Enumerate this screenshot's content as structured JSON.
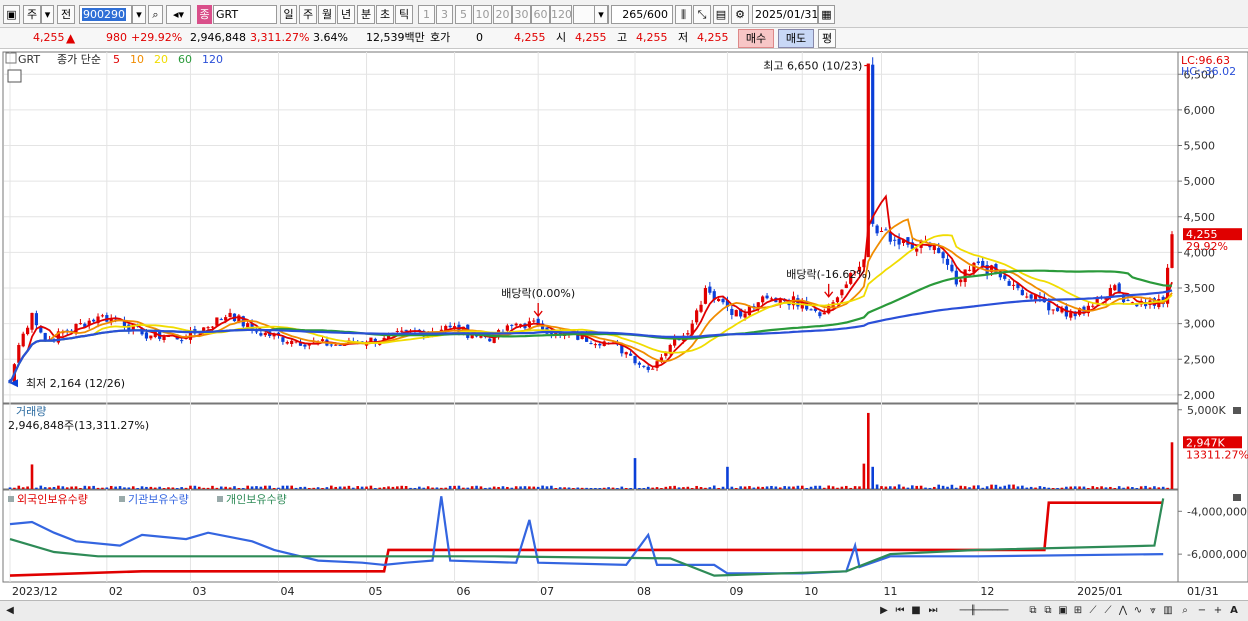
{
  "toolbar": {
    "market_label": "주",
    "prev_label": "전",
    "code_value": "900290",
    "stock_badge": "종",
    "stock_name": "GRT",
    "periods": [
      "일",
      "주",
      "월",
      "년",
      "분",
      "초",
      "틱"
    ],
    "selected_period": "일",
    "intervals": [
      "1",
      "3",
      "5",
      "10",
      "20",
      "30",
      "60",
      "120"
    ],
    "count_value": "265",
    "count_total": "/600",
    "date_value": "2025/01/31"
  },
  "quote": {
    "price": "4,255",
    "change": "980",
    "change_pct": "+29.92%",
    "volume": "2,946,848",
    "volume_ratio": "3,311.27%",
    "turnover": "3.64%",
    "amount": "12,539백만",
    "hoga_label": "호가",
    "hoga_value": "0",
    "hoga_price": "4,255",
    "open_label": "시",
    "open_value": "4,255",
    "high_label": "고",
    "high_value": "4,255",
    "low_label": "저",
    "low_value": "4,255",
    "buy_label": "매수",
    "sell_label": "매도",
    "eval_label": "평"
  },
  "colors": {
    "up": "#e00000",
    "down": "#0a3fd8",
    "ma5": "#e00000",
    "ma10": "#f08c00",
    "ma20": "#f0dc00",
    "ma60": "#2a9a3a",
    "ma120": "#2a4fd8",
    "foreign": "#e00000",
    "institution": "#3465e0",
    "individual": "#2e8b57"
  },
  "chart_data": [
    {
      "type": "candlestick",
      "legend_code": "GRT",
      "legend_title": "종가 단순",
      "ma_periods": [
        "5",
        "10",
        "20",
        "60",
        "120"
      ],
      "y_ticks": [
        "6,500",
        "6,000",
        "5,500",
        "5,000",
        "4,500",
        "4,000",
        "3,500",
        "3,000",
        "2,500",
        "2,000"
      ],
      "y_range": [
        1900,
        6700
      ],
      "x_months": [
        "2023/12",
        "02",
        "03",
        "04",
        "05",
        "06",
        "07",
        "08",
        "09",
        "10",
        "11",
        "12",
        "2025/01",
        "01/31"
      ],
      "x_month_index": [
        0,
        22,
        41,
        61,
        81,
        101,
        120,
        142,
        163,
        180,
        198,
        220,
        242
      ],
      "n_bars": 265,
      "close_keypoints": [
        [
          0,
          2164
        ],
        [
          2,
          2700
        ],
        [
          5,
          3150
        ],
        [
          8,
          2750
        ],
        [
          20,
          3100
        ],
        [
          25,
          3050
        ],
        [
          30,
          2850
        ],
        [
          40,
          2800
        ],
        [
          50,
          3150
        ],
        [
          55,
          2900
        ],
        [
          65,
          2750
        ],
        [
          75,
          2700
        ],
        [
          85,
          2800
        ],
        [
          100,
          2950
        ],
        [
          105,
          2850
        ],
        [
          110,
          2800
        ],
        [
          115,
          3000
        ],
        [
          120,
          2980
        ],
        [
          125,
          2850
        ],
        [
          135,
          2750
        ],
        [
          140,
          2600
        ],
        [
          145,
          2350
        ],
        [
          150,
          2700
        ],
        [
          155,
          3000
        ],
        [
          158,
          3500
        ],
        [
          162,
          3300
        ],
        [
          166,
          3100
        ],
        [
          170,
          3300
        ],
        [
          175,
          3350
        ],
        [
          180,
          3300
        ],
        [
          185,
          3150
        ],
        [
          190,
          3550
        ],
        [
          194,
          3900
        ],
        [
          195,
          6650
        ],
        [
          196,
          4400
        ],
        [
          198,
          4300
        ],
        [
          200,
          4150
        ],
        [
          205,
          4050
        ],
        [
          210,
          4100
        ],
        [
          215,
          3550
        ],
        [
          220,
          3850
        ],
        [
          225,
          3650
        ],
        [
          230,
          3400
        ],
        [
          235,
          3300
        ],
        [
          240,
          3100
        ],
        [
          245,
          3250
        ],
        [
          250,
          3500
        ],
        [
          255,
          3300
        ],
        [
          262,
          3275
        ],
        [
          264,
          4255
        ]
      ],
      "annotations": [
        {
          "label": "최고 6,650 (10/23)",
          "index": 195,
          "value": 6650
        },
        {
          "label": "최저 2,164 (12/26)",
          "index": 0,
          "value": 2164
        },
        {
          "label": "배당락(0.00%)",
          "index": 120,
          "value": 2980
        },
        {
          "label": "배당락(-16.62%)",
          "index": 186,
          "value": 3250
        }
      ],
      "lc_label": "LC:96.63",
      "hc_label": "HC:-36.02",
      "last_price_label": "4,255",
      "last_pct_label": "29.92%"
    },
    {
      "type": "bar",
      "title": "거래량",
      "subtitle": "2,946,848주(13,311.27%)",
      "y_ticks": [
        "5,000K"
      ],
      "y_range": [
        0,
        5300000
      ],
      "last_label": "2,947K",
      "last_pct_label": "13311.27%",
      "spikes": [
        [
          5,
          1550000
        ],
        [
          142,
          1950000
        ],
        [
          163,
          1400000
        ],
        [
          194,
          1600000
        ],
        [
          195,
          4800000
        ],
        [
          196,
          1400000
        ],
        [
          264,
          2947000
        ]
      ]
    },
    {
      "type": "line",
      "legend": [
        "외국인보유수량",
        "기관보유수량",
        "개인보유수량"
      ],
      "y_ticks": [
        "-4,000,000",
        "-6,000,000"
      ],
      "y_range": [
        -7300000,
        -3100000
      ],
      "series": [
        {
          "name": "외국인보유수량",
          "points": [
            [
              0,
              -7000000
            ],
            [
              30,
              -6800000
            ],
            [
              85,
              -6800000
            ],
            [
              86,
              -5800000
            ],
            [
              215,
              -5800000
            ],
            [
              235,
              -5800000
            ],
            [
              236,
              -3600000
            ],
            [
              262,
              -3600000
            ]
          ]
        },
        {
          "name": "기관보유수량",
          "points": [
            [
              0,
              -4600000
            ],
            [
              5,
              -4500000
            ],
            [
              10,
              -5000000
            ],
            [
              15,
              -5400000
            ],
            [
              25,
              -5600000
            ],
            [
              30,
              -5100000
            ],
            [
              40,
              -5300000
            ],
            [
              45,
              -5000000
            ],
            [
              55,
              -5400000
            ],
            [
              60,
              -5800000
            ],
            [
              70,
              -6300000
            ],
            [
              80,
              -6400000
            ],
            [
              85,
              -6500000
            ],
            [
              90,
              -6400000
            ],
            [
              96,
              -6300000
            ],
            [
              98,
              -3300000
            ],
            [
              100,
              -6300000
            ],
            [
              115,
              -6400000
            ],
            [
              118,
              -4400000
            ],
            [
              120,
              -6400000
            ],
            [
              140,
              -6500000
            ],
            [
              145,
              -5100000
            ],
            [
              147,
              -6500000
            ],
            [
              160,
              -6500000
            ],
            [
              163,
              -6900000
            ],
            [
              180,
              -6900000
            ],
            [
              190,
              -6800000
            ],
            [
              192,
              -5600000
            ],
            [
              193,
              -6600000
            ],
            [
              200,
              -6100000
            ],
            [
              220,
              -6100000
            ],
            [
              262,
              -6000000
            ]
          ]
        },
        {
          "name": "개인보유수량",
          "points": [
            [
              0,
              -5300000
            ],
            [
              10,
              -5900000
            ],
            [
              20,
              -6100000
            ],
            [
              60,
              -6100000
            ],
            [
              80,
              -6100000
            ],
            [
              110,
              -6100000
            ],
            [
              150,
              -6200000
            ],
            [
              160,
              -7000000
            ],
            [
              190,
              -6800000
            ],
            [
              200,
              -6000000
            ],
            [
              220,
              -5800000
            ],
            [
              260,
              -5600000
            ],
            [
              262,
              -3400000
            ]
          ]
        }
      ]
    }
  ],
  "bottom": {
    "zoom_out": "−",
    "zoom_in": "+",
    "font_label": "A"
  }
}
